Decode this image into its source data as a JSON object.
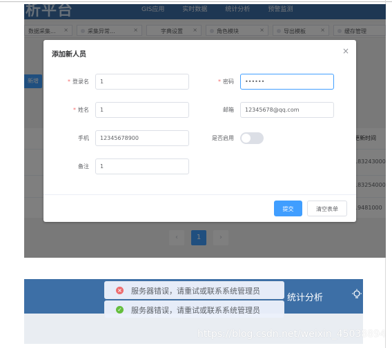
{
  "app": {
    "brand": "析平台",
    "top_nav": [
      "GIS应用",
      "实时数据",
      "统计分析",
      "预警监测"
    ],
    "tabs": [
      "数据采集...",
      "采集异常...",
      "字典设置",
      "角色模块",
      "导出模板",
      "缓存管理"
    ],
    "add_button": "新增",
    "table_header_last": "更新时间",
    "table_cells_last": [
      "183243000",
      "183254000",
      "19481000"
    ],
    "pager": {
      "prev": "‹",
      "current": "1",
      "next": "›"
    }
  },
  "dialog": {
    "title": "添加新人员",
    "close": "×",
    "fields": {
      "username": {
        "label": "登录名",
        "value": "1",
        "required": true
      },
      "password": {
        "label": "密码",
        "value": "••••••",
        "required": true
      },
      "name": {
        "label": "姓名",
        "value": "1",
        "required": true
      },
      "email": {
        "label": "邮箱",
        "value": "12345678@qq.com",
        "required": false
      },
      "phone": {
        "label": "手机",
        "value": "12345678900",
        "required": false
      },
      "enabled": {
        "label": "是否启用",
        "on": false
      },
      "remark": {
        "label": "备注",
        "value": "1",
        "required": false
      }
    },
    "submit": "提交",
    "reset": "清空表单"
  },
  "second_shot": {
    "nav_stat": "统计分析",
    "toasts": [
      {
        "type": "error",
        "text": "服务器错误，请重试或联系系统管理员"
      },
      {
        "type": "success",
        "text": "服务器错误，请重试或联系系统管理员"
      }
    ],
    "watermark": "https://blog.csdn.net/weixin_45038894"
  },
  "colors": {
    "primary": "#409eff",
    "header": "#3d6fa6",
    "error": "#f56c6c",
    "success": "#67c23a"
  }
}
